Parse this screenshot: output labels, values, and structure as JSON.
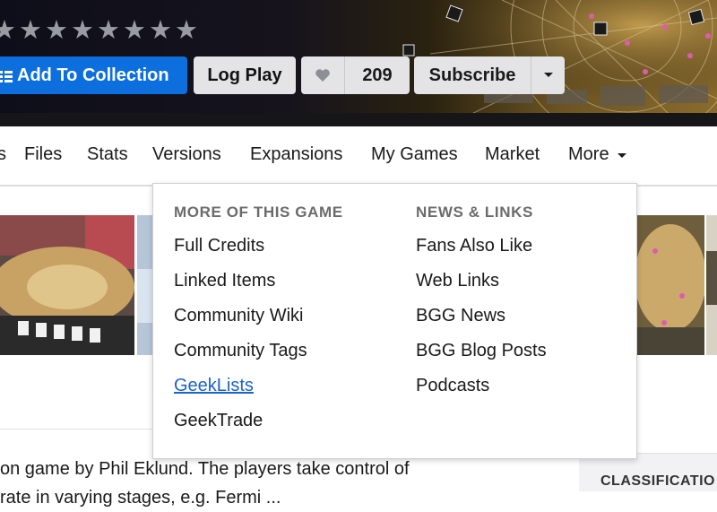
{
  "hero": {
    "stars": [
      "★",
      "★",
      "★",
      "★",
      "★",
      "★",
      "★",
      "★"
    ],
    "add_collection_label": "Add To Collection",
    "log_play_label": "Log Play",
    "like_count": "209",
    "subscribe_label": "Subscribe"
  },
  "nav": {
    "items": [
      "s",
      "Files",
      "Stats",
      "Versions",
      "Expansions",
      "My Games",
      "Market",
      "More"
    ]
  },
  "dropdown": {
    "col1_heading": "MORE OF THIS GAME",
    "col1_links": [
      "Full Credits",
      "Linked Items",
      "Community Wiki",
      "Community Tags",
      "GeekLists",
      "GeekTrade"
    ],
    "col2_heading": "NEWS & LINKS",
    "col2_links": [
      "Fans Also Like",
      "Web Links",
      "BGG News",
      "BGG Blog Posts",
      "Podcasts"
    ],
    "active_link": "GeekLists"
  },
  "description": {
    "line1": "on game by Phil Eklund. The players take control of",
    "line2": "rate in varying stages, e.g. Fermi ..."
  },
  "sidebar": {
    "classification_label": "CLASSIFICATIO"
  },
  "colors": {
    "primary_blue": "#0d6fde",
    "link_blue": "#1b62c9",
    "button_grey": "#e4e4e7"
  }
}
